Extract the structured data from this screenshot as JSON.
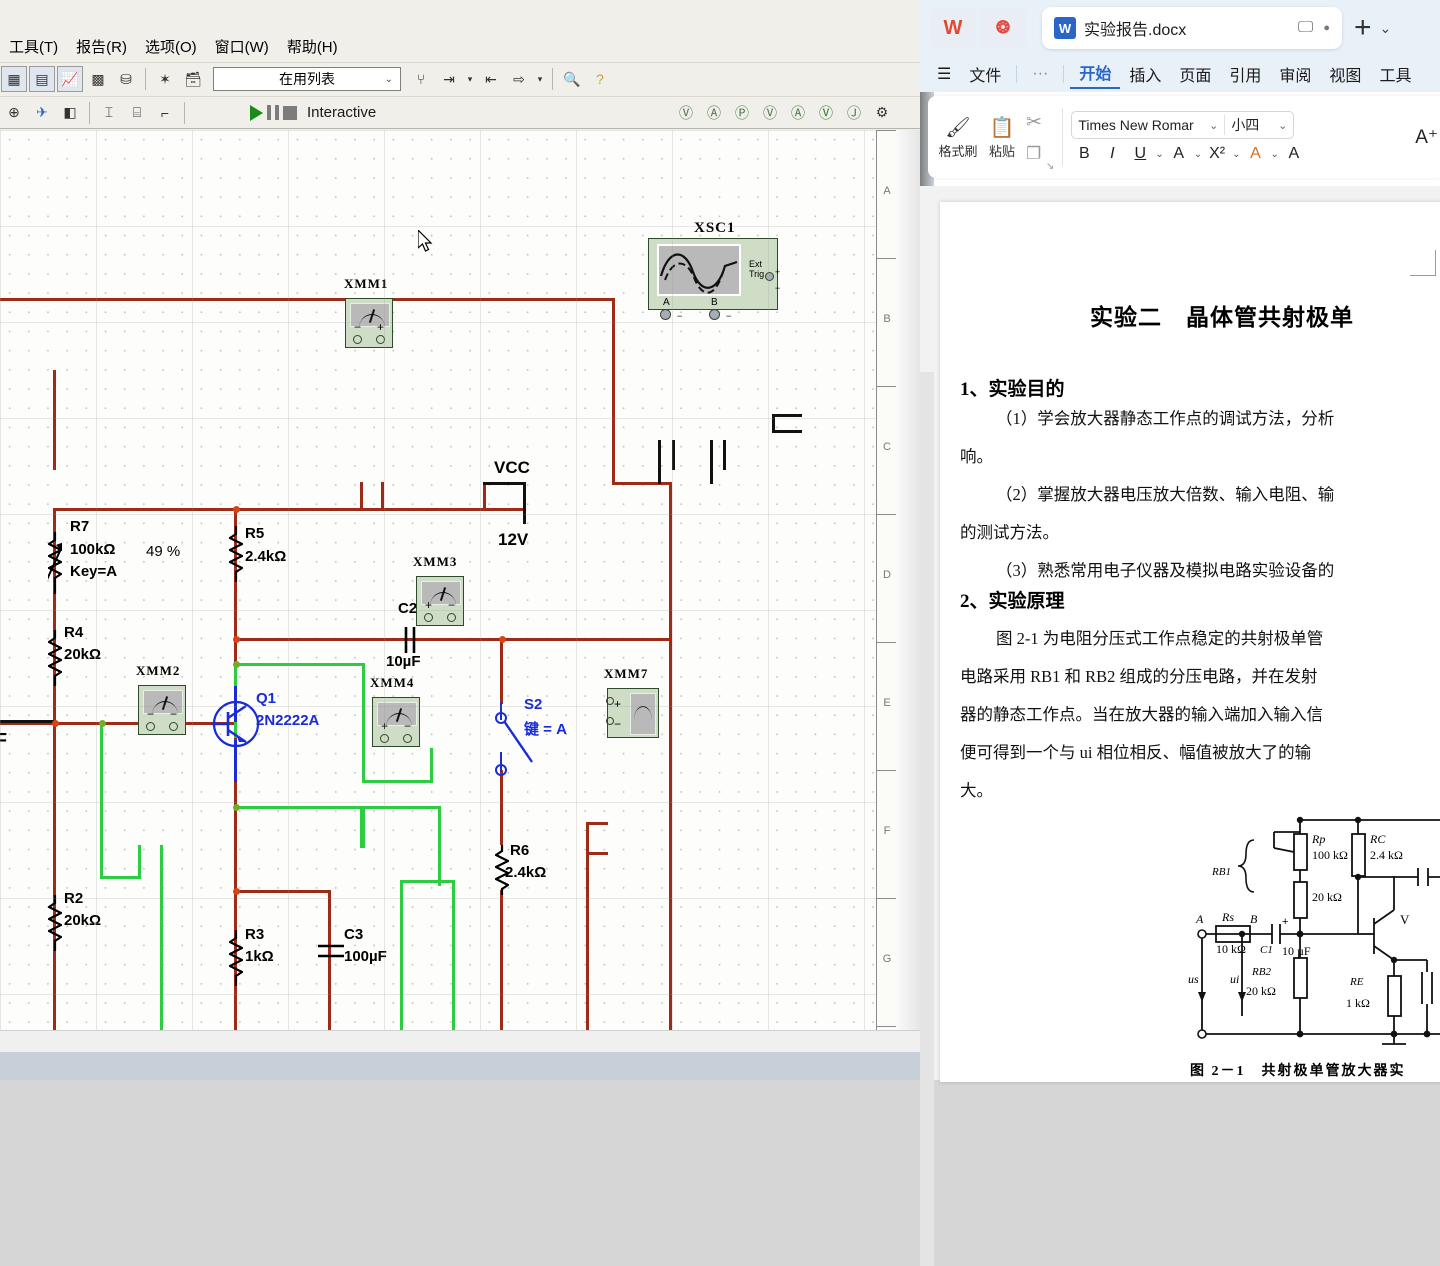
{
  "multisim": {
    "menu": [
      "工具(T)",
      "报告(R)",
      "选项(O)",
      "窗口(W)",
      "帮助(H)"
    ],
    "component_list": {
      "value": "在用列表",
      "caret": "⌄"
    },
    "simulation": {
      "run": "▶",
      "pause": "❚❚",
      "stop": "■",
      "mode_label": "Interactive"
    },
    "ruler_letters": [
      "A",
      "B",
      "C",
      "D",
      "E",
      "F",
      "G"
    ],
    "circuit": {
      "power": {
        "name": "VCC",
        "value": "12V"
      },
      "components": [
        {
          "ref": "R7",
          "value": "100kΩ",
          "extra": "Key=A",
          "percent": "49 %"
        },
        {
          "ref": "R4",
          "value": "20kΩ"
        },
        {
          "ref": "R5",
          "value": "2.4kΩ"
        },
        {
          "ref": "R2",
          "value": "20kΩ"
        },
        {
          "ref": "R3",
          "value": "1kΩ"
        },
        {
          "ref": "R6",
          "value": "2.4kΩ"
        },
        {
          "ref": "C2",
          "value": "10µF"
        },
        {
          "ref": "C3",
          "value": "100µF"
        },
        {
          "ref": "Q1",
          "value": "2N2222A"
        },
        {
          "ref": "S2",
          "value": "键 = A"
        }
      ],
      "instruments": [
        {
          "ref": "XMM1"
        },
        {
          "ref": "XMM2"
        },
        {
          "ref": "XMM3"
        },
        {
          "ref": "XMM4"
        },
        {
          "ref": "XMM7"
        },
        {
          "ref": "XSC1"
        }
      ],
      "scope": {
        "ref": "XSC1",
        "ext_trig": "Ext Trig",
        "ch_a": "A",
        "ch_b": "B",
        "plus": "+",
        "minus": "−"
      },
      "edge_label": "F"
    }
  },
  "wps": {
    "titlebar": {
      "app_badge": "W",
      "second_badge": "❂",
      "tab_icon": "W",
      "tab_name": "实验报告.docx",
      "monitor_icon": "🖵",
      "dot_icon": "●",
      "new_tab": "+",
      "caret": "⌄"
    },
    "menu": {
      "hamburger": "☰",
      "file": "文件",
      "more": "···",
      "tabs": [
        "开始",
        "插入",
        "页面",
        "引用",
        "审阅",
        "视图",
        "工具"
      ],
      "active_tab": "开始"
    },
    "ribbon": {
      "format_painter": "格式刷",
      "paste": "粘贴",
      "paste_caret": "⌄",
      "cut_icon": "✂",
      "copy_icon": "❐",
      "font_name": "Times New Romar",
      "font_size": "小四",
      "grow_font": "A⁺",
      "bold": "B",
      "italic": "I",
      "underline": "U",
      "underline_caret": "⌄",
      "pinyin": "A",
      "pinyin_caret": "⌄",
      "superscript": "X²",
      "sup_caret": "⌄",
      "font_color": "A",
      "font_color_caret": "⌄",
      "highlight": "A",
      "dialog_launcher": "↘",
      "dropdown_caret": "⌄"
    },
    "document": {
      "title": "实验二　晶体管共射极单",
      "section1": "1、实验目的",
      "p1_a": "（1）学会放大器静态工作点的调试方法，分析",
      "p1_b": "响。",
      "p2_a": "（2）掌握放大器电压放大倍数、输入电阻、输",
      "p2_b": "的测试方法。",
      "p3_a": "（3）熟悉常用电子仪器及模拟电路实验设备的",
      "section2": "2、实验原理",
      "p4_a": "图 2-1 为电阻分压式工作点稳定的共射极单管",
      "p4_b": "电路采用 RB1 和 RB2 组成的分压电路，并在发射",
      "p4_c": "器的静态工作点。当在放大器的输入端加入输入信",
      "p4_d": "便可得到一个与 ui 相位相反、幅值被放大了的输",
      "p4_e": "大。",
      "figure_caption": "图 2－1　共射极单管放大器实",
      "figure": {
        "rb1": "RB1",
        "rp": "Rp",
        "rp_val": "100 kΩ",
        "r20k": "20 kΩ",
        "rc": "RC",
        "rc_val": "2.4 kΩ",
        "node_a": "A",
        "node_b": "B",
        "rs": "Rs",
        "rs_val": "10 kΩ",
        "c1": "C1",
        "c1_val": "10 µF",
        "c1_plus": "+",
        "rb2": "RB2",
        "rb2_val": "20 kΩ",
        "re": "RE",
        "re_val": "1 kΩ",
        "transistor": "V",
        "us": "us",
        "ui": "ui"
      }
    }
  },
  "colors": {
    "wire_red": "#9e2b18",
    "wire_green": "#2ecc40",
    "wire_blue": "#1a2bd8",
    "accent_blue": "#2a65c8",
    "meter_body": "#cfdcc6"
  }
}
